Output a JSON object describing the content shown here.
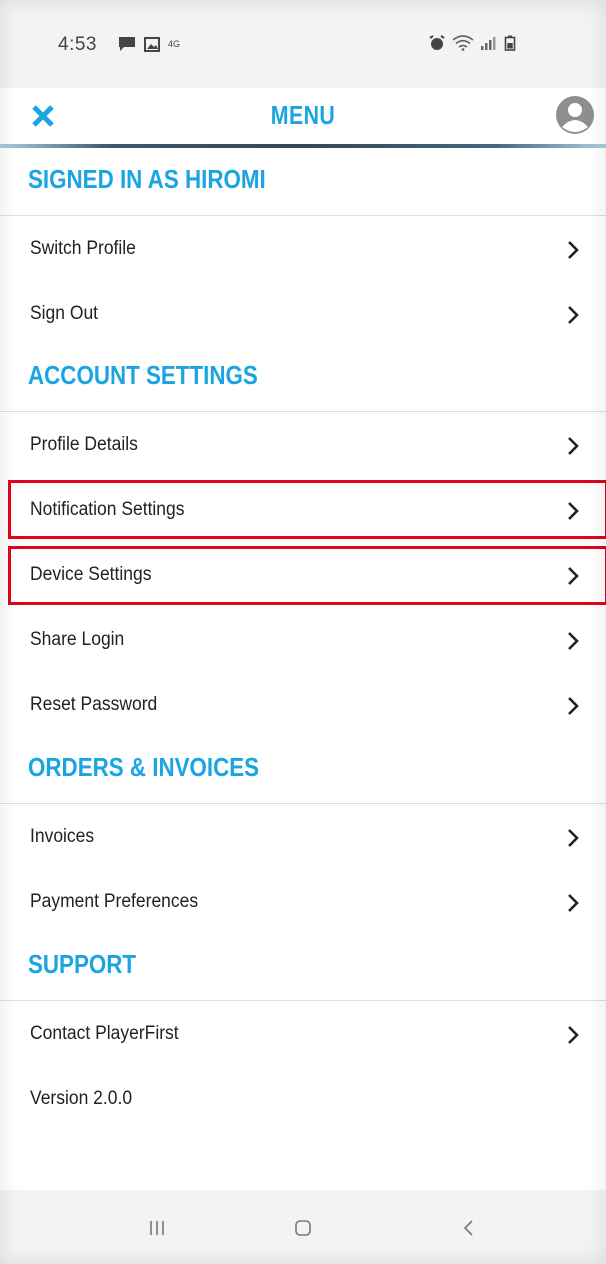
{
  "status_bar": {
    "time": "4:53",
    "network_label": "4G",
    "icons": [
      "chat-icon",
      "image-icon",
      "alarm-icon",
      "wifi-icon",
      "signal-icon",
      "battery-icon"
    ]
  },
  "header": {
    "title": "MENU",
    "close_icon": "close-icon",
    "profile_icon": "profile-icon"
  },
  "colors": {
    "accent": "#1aa4e2",
    "highlight": "#e0061a",
    "text": "#222222"
  },
  "sections": [
    {
      "title": "SIGNED IN AS HIROMI",
      "items": [
        {
          "label": "Switch Profile",
          "chevron": true
        },
        {
          "label": "Sign Out",
          "chevron": true
        }
      ]
    },
    {
      "title": "ACCOUNT SETTINGS",
      "items": [
        {
          "label": "Profile Details",
          "chevron": true
        },
        {
          "label": "Notification Settings",
          "chevron": true,
          "highlighted": true
        },
        {
          "label": "Device Settings",
          "chevron": true,
          "highlighted": true
        },
        {
          "label": "Share Login",
          "chevron": true
        },
        {
          "label": "Reset Password",
          "chevron": true
        }
      ]
    },
    {
      "title": "ORDERS & INVOICES",
      "items": [
        {
          "label": "Invoices",
          "chevron": true
        },
        {
          "label": "Payment Preferences",
          "chevron": true
        }
      ]
    },
    {
      "title": "SUPPORT",
      "items": [
        {
          "label": "Contact PlayerFirst",
          "chevron": true
        },
        {
          "label": "Version 2.0.0",
          "chevron": false
        }
      ]
    }
  ],
  "nav_bar": {
    "icons": [
      "recent-apps-icon",
      "home-icon",
      "back-icon"
    ]
  }
}
